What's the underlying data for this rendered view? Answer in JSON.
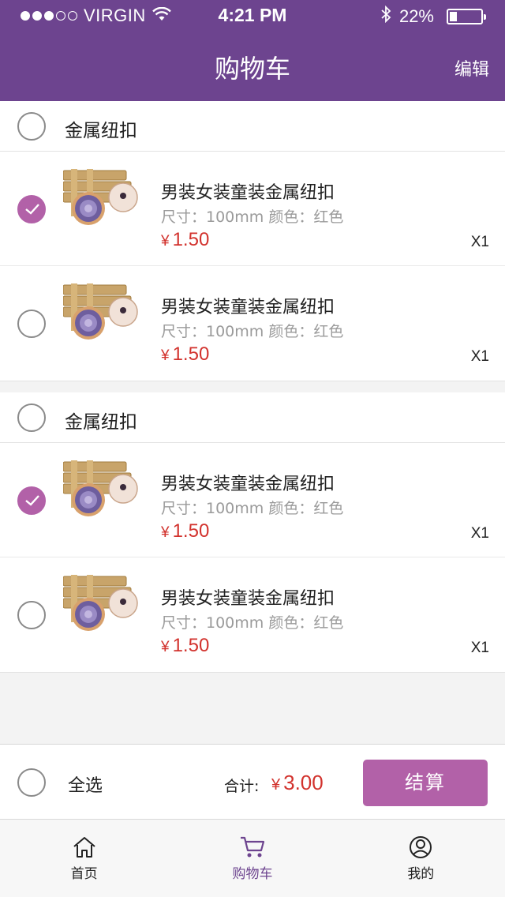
{
  "status_bar": {
    "carrier": "VIRGIN",
    "time": "4:21 PM",
    "battery_percent": "22%"
  },
  "nav": {
    "title": "购物车",
    "edit_label": "编辑"
  },
  "shops": [
    {
      "name": "金属纽扣",
      "checked": false,
      "items": [
        {
          "title": "男装女装童装金属纽扣",
          "spec": "尺寸：100mm 颜色：红色",
          "currency": "¥",
          "price": "1.50",
          "qty": "X1",
          "checked": true
        },
        {
          "title": "男装女装童装金属纽扣",
          "spec": "尺寸：100mm 颜色：红色",
          "currency": "¥",
          "price": "1.50",
          "qty": "X1",
          "checked": false
        }
      ]
    },
    {
      "name": "金属纽扣",
      "checked": false,
      "items": [
        {
          "title": "男装女装童装金属纽扣",
          "spec": "尺寸：100mm 颜色：红色",
          "currency": "¥",
          "price": "1.50",
          "qty": "X1",
          "checked": true
        },
        {
          "title": "男装女装童装金属纽扣",
          "spec": "尺寸：100mm 颜色：红色",
          "currency": "¥",
          "price": "1.50",
          "qty": "X1",
          "checked": false
        }
      ]
    }
  ],
  "checkout": {
    "select_all_label": "全选",
    "total_label": "合计:",
    "currency": "¥",
    "total": "3.00",
    "pay_label": "结算"
  },
  "tabbar": [
    {
      "label": "首页",
      "icon": "home-icon"
    },
    {
      "label": "购物车",
      "icon": "cart-icon",
      "active": true
    },
    {
      "label": "我的",
      "icon": "user-icon"
    }
  ],
  "colors": {
    "brand": "#6d448f",
    "accent": "#b261a8",
    "price": "#d2322d"
  }
}
